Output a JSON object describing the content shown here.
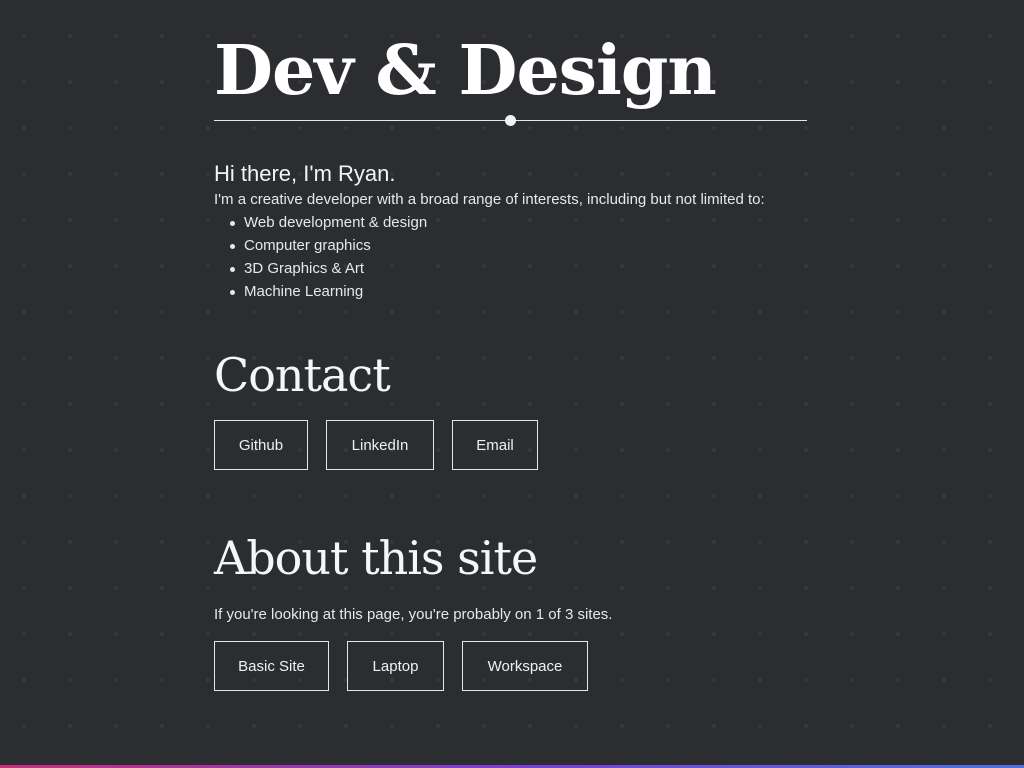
{
  "header": {
    "title": "Dev & Design"
  },
  "intro": {
    "greeting": "Hi there, I'm Ryan.",
    "description": "I'm a creative developer with a broad range of interests, including but not limited to:",
    "interests": [
      "Web development & design",
      "Computer graphics",
      "3D Graphics & Art",
      "Machine Learning"
    ]
  },
  "contact": {
    "heading": "Contact",
    "buttons": [
      "Github",
      "LinkedIn",
      "Email"
    ]
  },
  "about": {
    "heading": "About this site",
    "text": "If you're looking at this page, you're probably on 1 of 3 sites.",
    "buttons": [
      "Basic Site",
      "Laptop",
      "Workspace"
    ]
  },
  "colors": {
    "background": "#2b2d31",
    "text": "#eceef0",
    "bottom_gradient_start": "#c4317a",
    "bottom_gradient_mid": "#7a3fd0",
    "bottom_gradient_end": "#4f6fe0"
  }
}
